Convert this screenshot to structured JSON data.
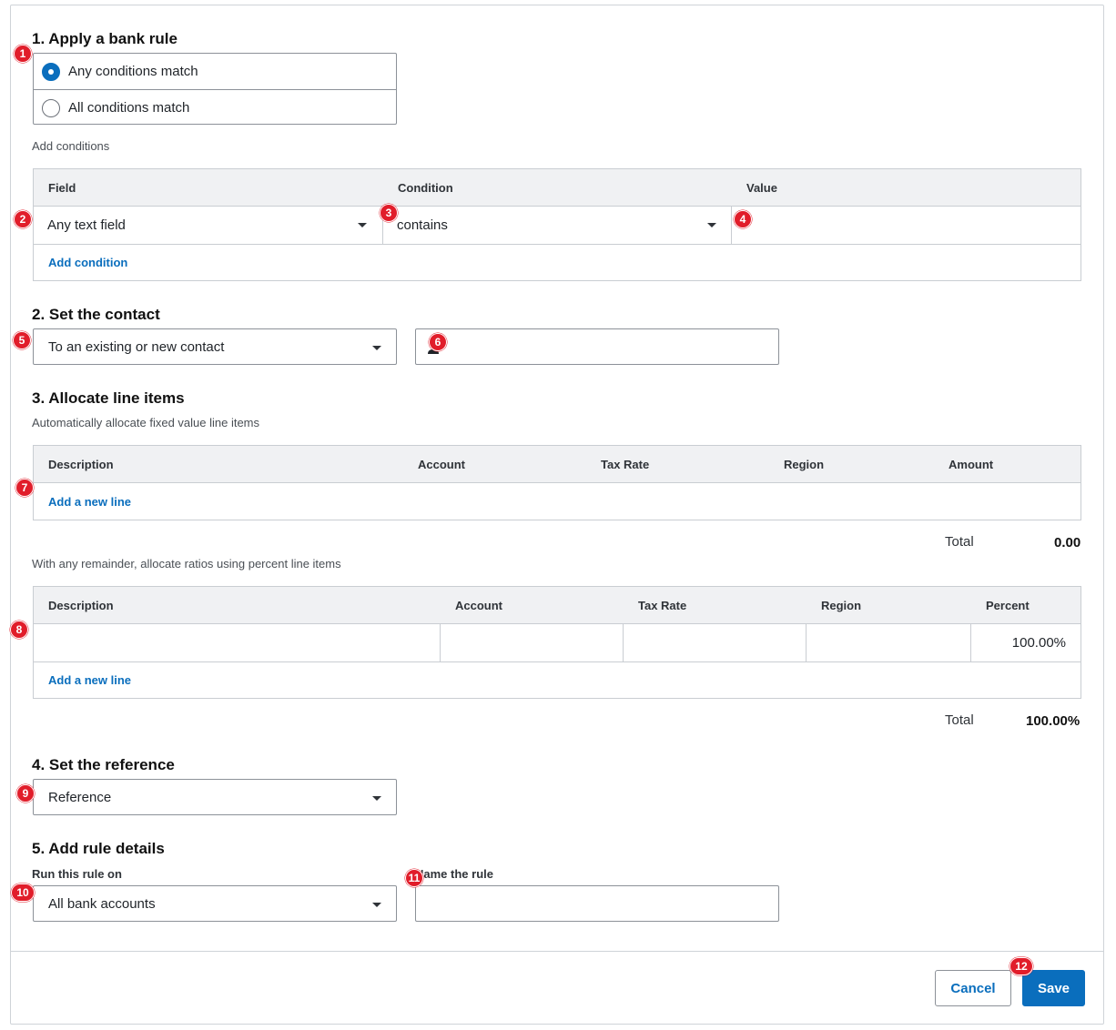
{
  "section1": {
    "title": "1. Apply a bank rule",
    "options": [
      {
        "label": "Any conditions match",
        "selected": true
      },
      {
        "label": "All conditions match",
        "selected": false
      }
    ],
    "add_conditions_label": "Add conditions",
    "table": {
      "headers": [
        "Field",
        "Condition",
        "Value"
      ],
      "row": {
        "field": "Any text field",
        "condition": "contains",
        "value": ""
      },
      "add_link": "Add condition"
    }
  },
  "section2": {
    "title": "2. Set the contact",
    "contact_mode": "To an existing or new contact",
    "contact_value": ""
  },
  "section3": {
    "title": "3. Allocate line items",
    "fixed_subtitle": "Automatically allocate fixed value line items",
    "fixed_table": {
      "headers": [
        "Description",
        "Account",
        "Tax Rate",
        "Region",
        "Amount"
      ],
      "add_link": "Add a new line",
      "total_label": "Total",
      "total_value": "0.00"
    },
    "percent_subtitle": "With any remainder, allocate ratios using percent line items",
    "percent_table": {
      "headers": [
        "Description",
        "Account",
        "Tax Rate",
        "Region",
        "Percent"
      ],
      "row": {
        "description": "",
        "account": "",
        "tax_rate": "",
        "region": "",
        "percent": "100.00%"
      },
      "add_link": "Add a new line",
      "total_label": "Total",
      "total_value": "100.00%"
    }
  },
  "section4": {
    "title": "4. Set the reference",
    "reference": "Reference"
  },
  "section5": {
    "title": "5. Add rule details",
    "run_on_label": "Run this rule on",
    "run_on_value": "All bank accounts",
    "name_label": "Name the rule",
    "name_value": ""
  },
  "footer": {
    "cancel_label": "Cancel",
    "save_label": "Save"
  },
  "badges": [
    "1",
    "2",
    "3",
    "4",
    "5",
    "6",
    "7",
    "8",
    "9",
    "10",
    "11",
    "12"
  ],
  "colors": {
    "accent": "#0a6ebd",
    "badge": "#e11d2a",
    "table_header": "#f0f1f3"
  }
}
